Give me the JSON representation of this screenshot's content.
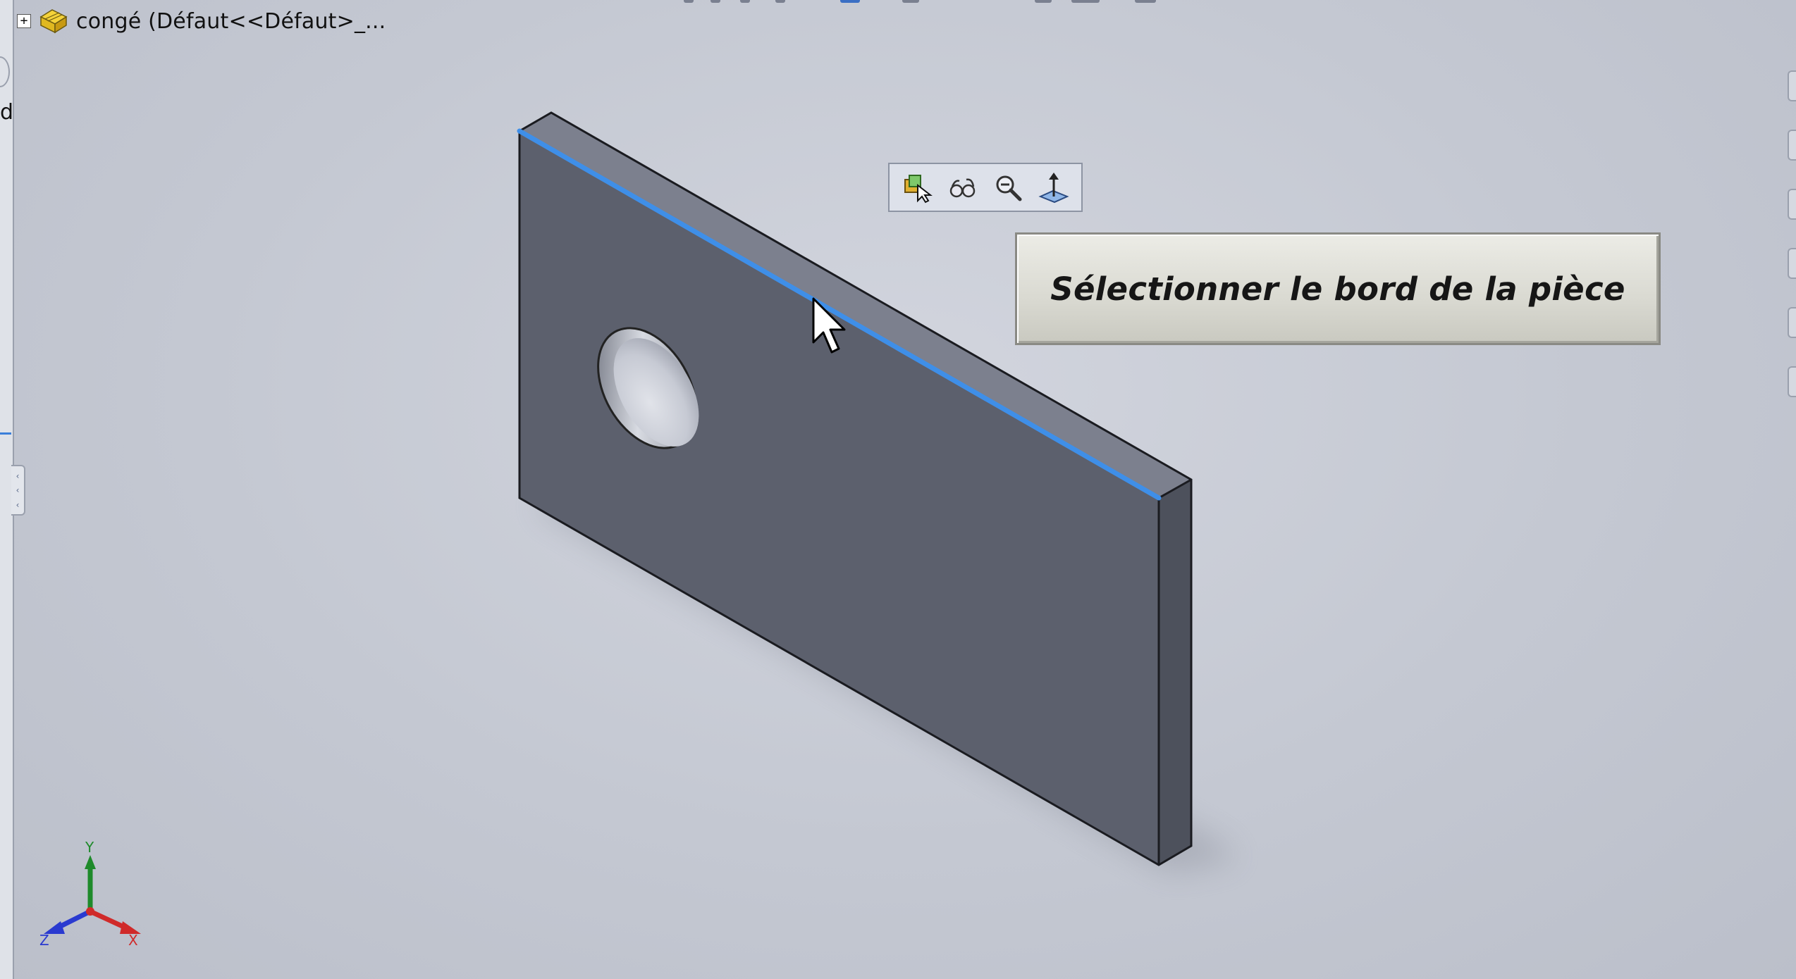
{
  "feature_tree": {
    "root_label": "congé  (Défaut<<Défaut>_...",
    "expand_symbol": "+",
    "icon": "part-icon"
  },
  "left_panel": {
    "cut_off_char": "d"
  },
  "context_toolbar": {
    "buttons": [
      {
        "name": "select-other-icon"
      },
      {
        "name": "hide-show-icon"
      },
      {
        "name": "zoom-to-selection-icon"
      },
      {
        "name": "normal-to-icon"
      }
    ]
  },
  "callout": {
    "text": "Sélectionner le bord de la pièce"
  },
  "triad": {
    "x": "X",
    "y": "Y",
    "z": "Z"
  },
  "colors": {
    "selected_edge": "#3f8fe8",
    "part_face": "#5c606d",
    "part_top": "#7a7e8c",
    "triad_x": "#d02a2a",
    "triad_y": "#1e8a2a",
    "triad_z": "#2a3ad0"
  }
}
